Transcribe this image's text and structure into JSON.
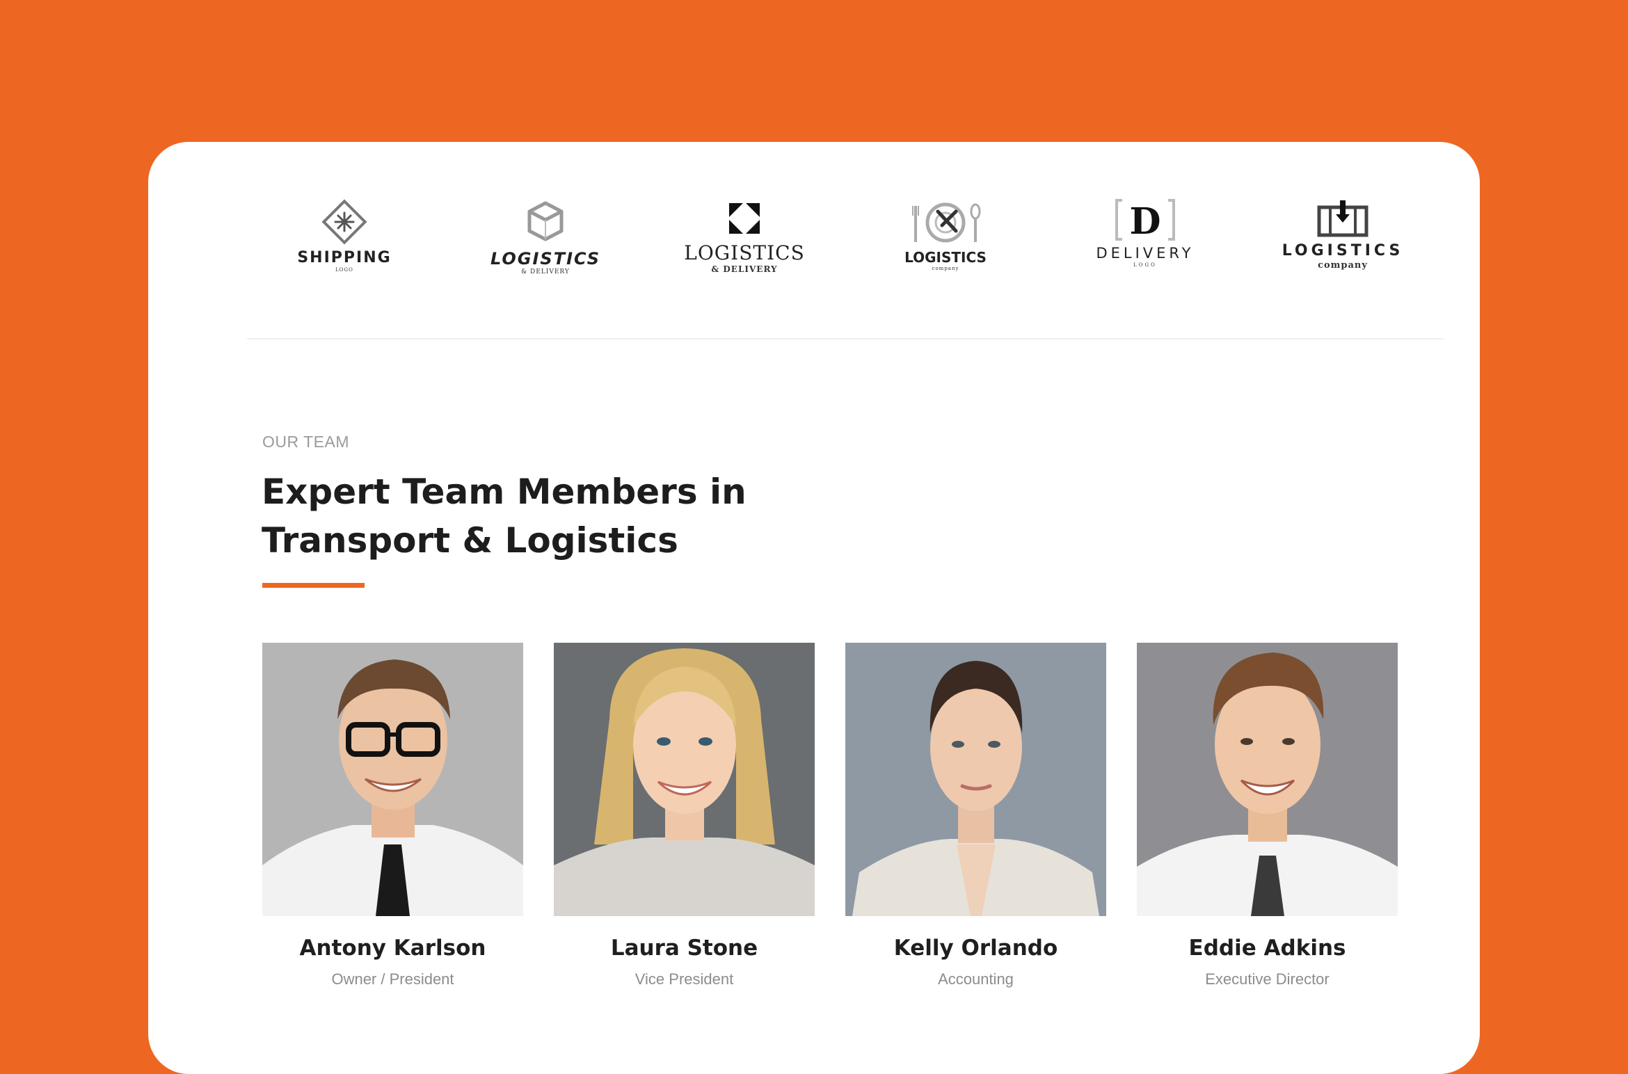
{
  "colors": {
    "accent": "#EE6722",
    "background": "#EE6722",
    "card": "#FFFFFF"
  },
  "logos": [
    {
      "icon": "diamond-snowflake-icon",
      "title": "SHIPPING",
      "subtitle": "LOGO"
    },
    {
      "icon": "cube-icon",
      "title": "LOGISTICS",
      "subtitle": "& DELIVERY"
    },
    {
      "icon": "corner-arrows-icon",
      "title": "LOGISTICS",
      "subtitle": "& DELIVERY"
    },
    {
      "icon": "plate-cutlery-icon",
      "title": "LOGISTICS",
      "subtitle": "company"
    },
    {
      "icon": "bracket-d-icon",
      "title": "DELIVERY",
      "subtitle": "LOGO"
    },
    {
      "icon": "box-arrow-icon",
      "title": "LOGISTICS",
      "subtitle": "company"
    }
  ],
  "team": {
    "eyebrow": "OUR TEAM",
    "heading_line1": "Expert Team Members in",
    "heading_line2": "Transport & Logistics",
    "members": [
      {
        "name": "Antony Karlson",
        "role": "Owner / President"
      },
      {
        "name": "Laura Stone",
        "role": "Vice President"
      },
      {
        "name": "Kelly Orlando",
        "role": "Accounting"
      },
      {
        "name": "Eddie Adkins",
        "role": "Executive Director"
      }
    ]
  }
}
